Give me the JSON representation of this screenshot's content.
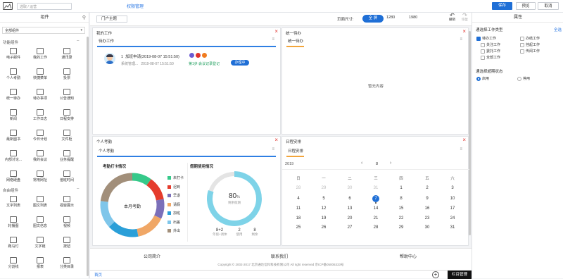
{
  "topbar": {
    "page_name_placeholder": "选取 / 运营",
    "perm_link": "权限管理",
    "save": "保存",
    "preview": "预览",
    "cancel": "取消"
  },
  "left_panel": {
    "title": "组件",
    "select_value": "全部组件",
    "section1": "功能组件",
    "section2": "自由组件",
    "func_items": [
      "电子邮件",
      "我的工作",
      "通讯录",
      "个人考勤",
      "快捷菜单",
      "投票",
      "统一待办",
      "待办事项",
      "公告通知",
      "新闻",
      "工作日志",
      "日程安排",
      "最新图书",
      "今日计划",
      "文件柜",
      "内部讨论...",
      "我的会议",
      "业务提醒",
      "网络硬盘",
      "常用网址",
      "值班时间"
    ],
    "free_items": [
      "文字列表",
      "图文列表",
      "视窗展示",
      "轮播图",
      "图文信息",
      "视频",
      "跑马灯",
      "文字链",
      "按钮",
      "分割线",
      "报表",
      "分类目录"
    ]
  },
  "toolbar": {
    "portal": "门户主题",
    "size_label": "页面尺寸:",
    "size_full": "全 屏",
    "size_1280": "1280",
    "size_1980": "1980",
    "undo": "撤销",
    "redo": "恢复"
  },
  "my_work": {
    "title": "我的工作",
    "tab": "待办工作",
    "item_index": "1",
    "item_title": "加班申请(2019-08-07 15:51:50)",
    "item_sub": "系统管理...",
    "item_time": "2019-08-07 15:51:50",
    "item_step": "第1步:会议记录登记",
    "item_status": "办理中"
  },
  "todo": {
    "title": "统一待办",
    "tab": "统一待办",
    "empty": "暂无内容"
  },
  "attendance": {
    "title": "个人考勤",
    "tab": "个人考勤",
    "card_title": "考勤打卡情况",
    "center": "本月考勤",
    "legend": [
      {
        "label": "未打卡",
        "color": "#36c98a"
      },
      {
        "label": "迟到",
        "color": "#e53b2c"
      },
      {
        "label": "早退",
        "color": "#7b6fb9"
      },
      {
        "label": "请假",
        "color": "#f0a766"
      },
      {
        "label": "加班",
        "color": "#2a9fd8"
      },
      {
        "label": "出差",
        "color": "#7fc6ea"
      },
      {
        "label": "外出",
        "color": "#a28f7a"
      }
    ],
    "ring_values": [
      10,
      12,
      10,
      15,
      16,
      14,
      23
    ],
    "leave_title": "假期使用情况",
    "leave_percent": "80",
    "leave_percent_unit": "%",
    "leave_sub": "剩余假期",
    "leave_color": "#7ed3e8",
    "stats": [
      {
        "value": "8+2",
        "label": "年假+调休"
      },
      {
        "value": "2",
        "label": "使用"
      },
      {
        "value": "8",
        "label": "剩余"
      }
    ]
  },
  "schedule": {
    "title": "日程安排",
    "tab": "日程安排",
    "year": "2019",
    "month": "8",
    "weekdays": [
      "日",
      "一",
      "二",
      "三",
      "四",
      "五",
      "六"
    ],
    "weeks": [
      [
        {
          "d": "28",
          "g": true
        },
        {
          "d": "29",
          "g": true
        },
        {
          "d": "30",
          "g": true
        },
        {
          "d": "31",
          "g": true
        },
        {
          "d": "1"
        },
        {
          "d": "2"
        },
        {
          "d": "3"
        }
      ],
      [
        {
          "d": "4"
        },
        {
          "d": "5"
        },
        {
          "d": "6"
        },
        {
          "d": "7",
          "today": true
        },
        {
          "d": "8"
        },
        {
          "d": "9"
        },
        {
          "d": "10"
        }
      ],
      [
        {
          "d": "11"
        },
        {
          "d": "12"
        },
        {
          "d": "13"
        },
        {
          "d": "14"
        },
        {
          "d": "15"
        },
        {
          "d": "16"
        },
        {
          "d": "17"
        }
      ],
      [
        {
          "d": "18"
        },
        {
          "d": "19"
        },
        {
          "d": "20"
        },
        {
          "d": "21"
        },
        {
          "d": "22"
        },
        {
          "d": "23"
        },
        {
          "d": "24"
        }
      ],
      [
        {
          "d": "25"
        },
        {
          "d": "26"
        },
        {
          "d": "27"
        },
        {
          "d": "28"
        },
        {
          "d": "29"
        },
        {
          "d": "30"
        },
        {
          "d": "31"
        }
      ]
    ]
  },
  "footer": {
    "links": [
      "公司简介",
      "联系我们",
      "帮助中心"
    ],
    "copyright": "Copyright © 2002-2017 北京通达信科科技有限公司 All right reserved 京ICP备05006333号"
  },
  "bottombar": {
    "home_tab": "首页",
    "menu_manage": "栏目管理"
  },
  "right_panel": {
    "title": "属性",
    "section1": "通选择工作类型",
    "select_all": "全选",
    "options": [
      {
        "label": "待办工作",
        "checked": true
      },
      {
        "label": "办结工作",
        "checked": false
      },
      {
        "label": "关注工作",
        "checked": false
      },
      {
        "label": "挂起工作",
        "checked": false
      },
      {
        "label": "委托工作",
        "checked": false
      },
      {
        "label": "传阅工作",
        "checked": false
      },
      {
        "label": "全部工作",
        "checked": false
      }
    ],
    "section2": "通选择超期状态",
    "radios": [
      {
        "label": "启用",
        "on": true
      },
      {
        "label": "停用",
        "on": false
      }
    ]
  }
}
